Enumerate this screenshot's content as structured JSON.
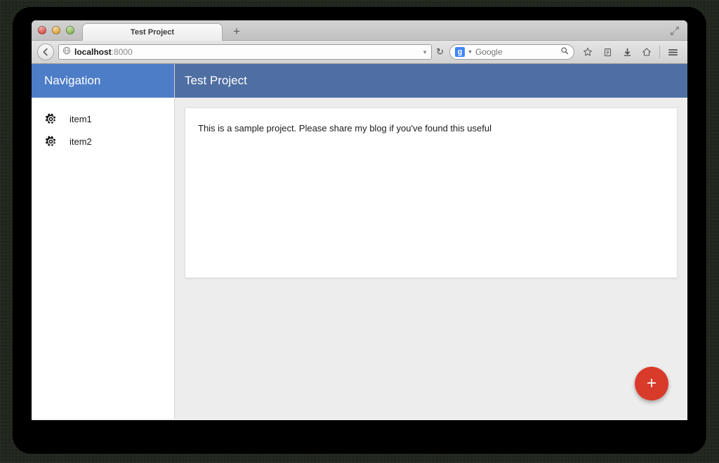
{
  "window": {
    "traffic_lights": [
      "close",
      "minimize",
      "zoom"
    ],
    "fullscreen_icon": "fullscreen-arrows-icon"
  },
  "browser": {
    "tab": {
      "title": "Test Project"
    },
    "new_tab_label": "+",
    "back_label": "←",
    "url": {
      "host": "localhost",
      "port": ":8000",
      "favicon": "globe-icon",
      "dropdown": "▼"
    },
    "reload_label": "↻",
    "search": {
      "engine_badge": "g",
      "engine_caret": "▼",
      "placeholder": "Google",
      "magnifier": "search-icon"
    },
    "toolbar_icons": [
      {
        "name": "bookmark-star-icon",
        "glyph": "☆"
      },
      {
        "name": "reading-list-icon",
        "glyph": "▤"
      },
      {
        "name": "downloads-icon",
        "glyph": "⬇"
      },
      {
        "name": "home-icon",
        "glyph": "⌂"
      },
      {
        "name": "menu-hamburger-icon",
        "glyph": "☰"
      }
    ]
  },
  "page": {
    "sidebar": {
      "title": "Navigation",
      "items": [
        {
          "label": "item1",
          "icon": "gear-icon"
        },
        {
          "label": "item2",
          "icon": "gear-icon"
        }
      ]
    },
    "main": {
      "title": "Test Project",
      "card_text": "This is a sample project. Please share my blog if you've found this useful",
      "fab_label": "+"
    }
  },
  "colors": {
    "sidebar_header": "#4d7dc7",
    "main_header": "#4f6fa3",
    "fab": "#d93b2b",
    "page_background": "#ededed"
  }
}
